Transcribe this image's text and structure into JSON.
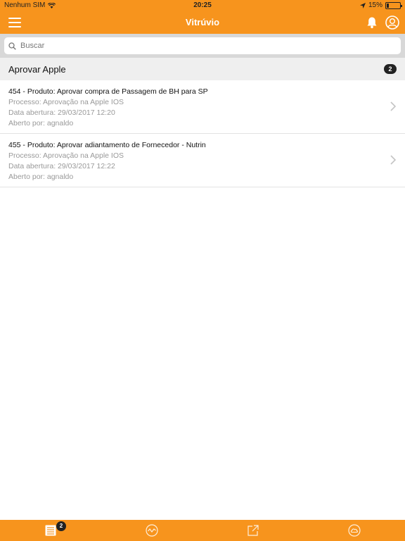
{
  "status_bar": {
    "carrier": "Nenhum SIM",
    "time": "20:25",
    "battery": "15%"
  },
  "navbar": {
    "title": "Vitrúvio",
    "left_icon": "hamburger-menu-icon",
    "right_icons": [
      "bell-icon",
      "user-profile-icon"
    ]
  },
  "search": {
    "placeholder": "Buscar",
    "value": ""
  },
  "section": {
    "title": "Aprovar Apple",
    "count": "2"
  },
  "items": [
    {
      "title": "454 - Produto: Aprovar compra de Passagem de BH para SP",
      "processo": "Processo: Aprovação na Apple IOS",
      "data": "Data abertura: 29/03/2017 12:20",
      "aberto": "Aberto por: agnaldo"
    },
    {
      "title": "455 - Produto: Aprovar adiantamento de Fornecedor - Nutrin",
      "processo": "Processo: Aprovação na Apple IOS",
      "data": "Data abertura: 29/03/2017 12:22",
      "aberto": "Aberto por: agnaldo"
    }
  ],
  "tabbar": {
    "tabs": [
      {
        "icon": "list-icon",
        "badge": "2"
      },
      {
        "icon": "chart-wave-icon"
      },
      {
        "icon": "external-link-icon"
      },
      {
        "icon": "cloud-icon"
      }
    ]
  },
  "colors": {
    "accent": "#f7941d",
    "badge": "#222222",
    "secondary_text": "#999999"
  }
}
